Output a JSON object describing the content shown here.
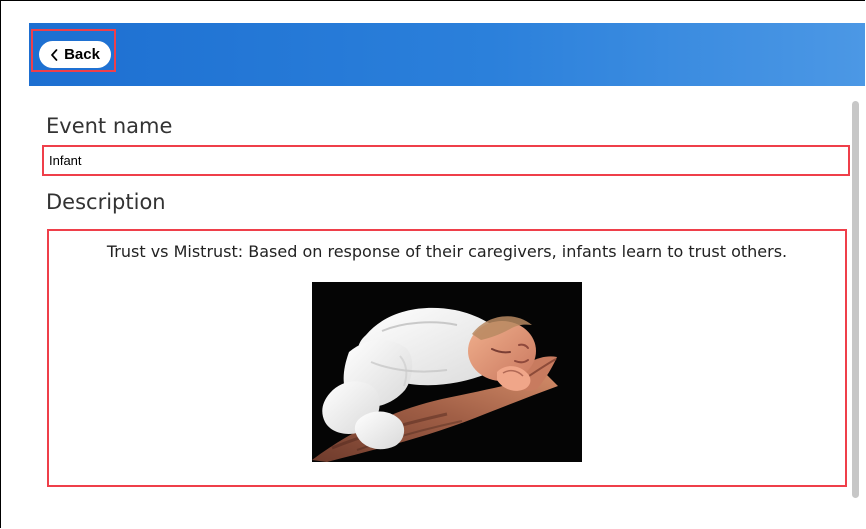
{
  "header": {
    "back_label": "Back",
    "gradient_colors": [
      "#1d6fd1",
      "#2b80db",
      "#4c98e5"
    ]
  },
  "form": {
    "event_name_label": "Event name",
    "event_name_value": "Infant",
    "description_label": "Description",
    "description_text": "Trust vs Mistrust: Based on response of their caregivers, infants learn to trust others."
  },
  "icons": {
    "back": "chevron-left-icon"
  },
  "colors": {
    "highlight": "#ef3f4a",
    "text": "#333333",
    "scrollbar": "#c7c7c7"
  }
}
